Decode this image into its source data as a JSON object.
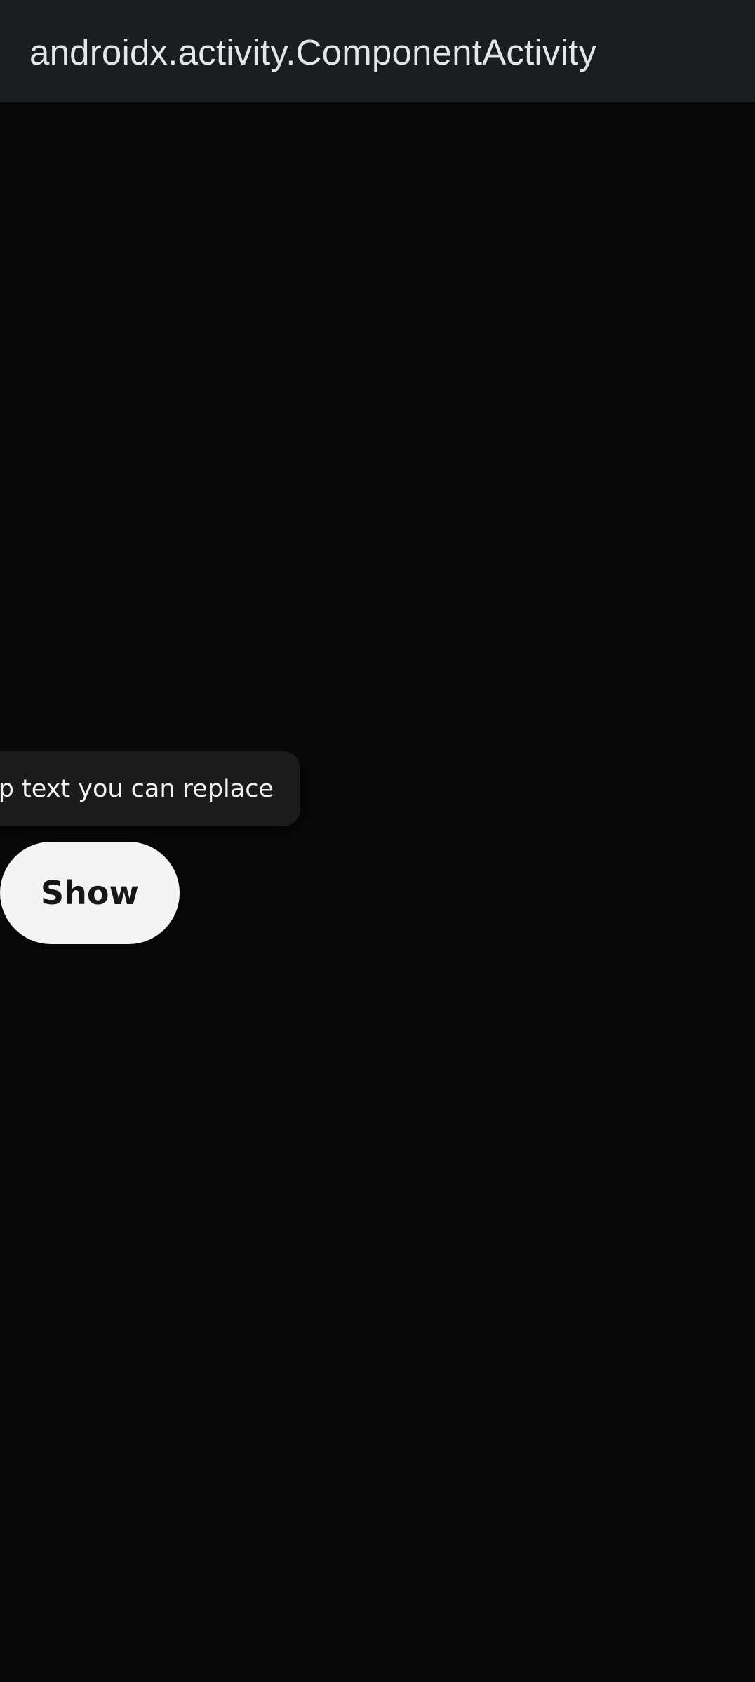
{
  "app_bar": {
    "title": "androidx.activity.ComponentActivity"
  },
  "tooltip": {
    "text": "ltip text you can replace"
  },
  "show_button": {
    "label": "Show"
  },
  "colors": {
    "app_bar_bg": "#1b1d20",
    "screen_bg": "#080808",
    "tooltip_bg": "#1b1b1b",
    "button_bg": "#f4f4f4"
  }
}
